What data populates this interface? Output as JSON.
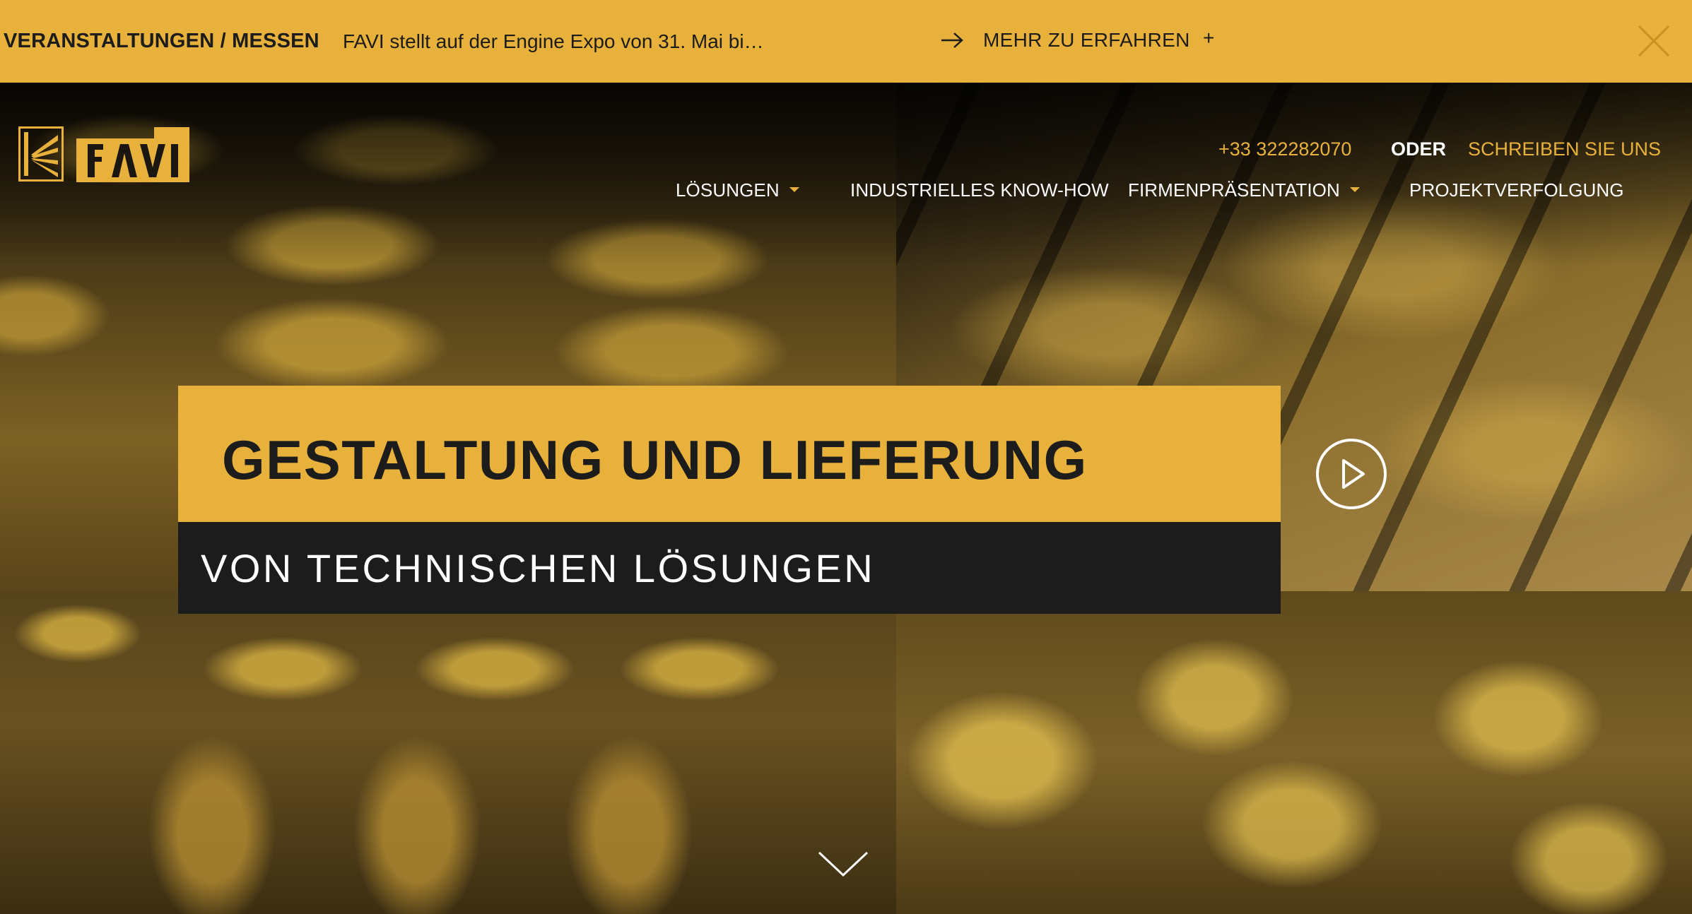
{
  "announcement": {
    "category": "VERANSTALTUNGEN / MESSEN",
    "text": "FAVI stellt auf der Engine Expo von 31. Mai bi…",
    "more_label": "MEHR ZU ERFAHREN",
    "plus": "+"
  },
  "brand": {
    "logo_text": "FAVI",
    "accent": "#e8b13b",
    "dark": "#1c1c1c"
  },
  "contact": {
    "phone": "+33 322282070",
    "or": "ODER",
    "write": "SCHREIBEN SIE UNS"
  },
  "nav": {
    "items": [
      {
        "label": "LÖSUNGEN",
        "has_dropdown": true
      },
      {
        "label": "INDUSTRIELLES KNOW-HOW",
        "has_dropdown": false
      },
      {
        "label": "FIRMENPRÄSENTATION",
        "has_dropdown": true
      },
      {
        "label": "PROJEKTVERFOLGUNG",
        "has_dropdown": false
      }
    ]
  },
  "hero": {
    "headline": "GESTALTUNG UND LIEFERUNG",
    "subheadline": "VON TECHNISCHEN LÖSUNGEN",
    "icons": {
      "play": "play-icon",
      "scroll": "chevron-down-icon"
    }
  }
}
